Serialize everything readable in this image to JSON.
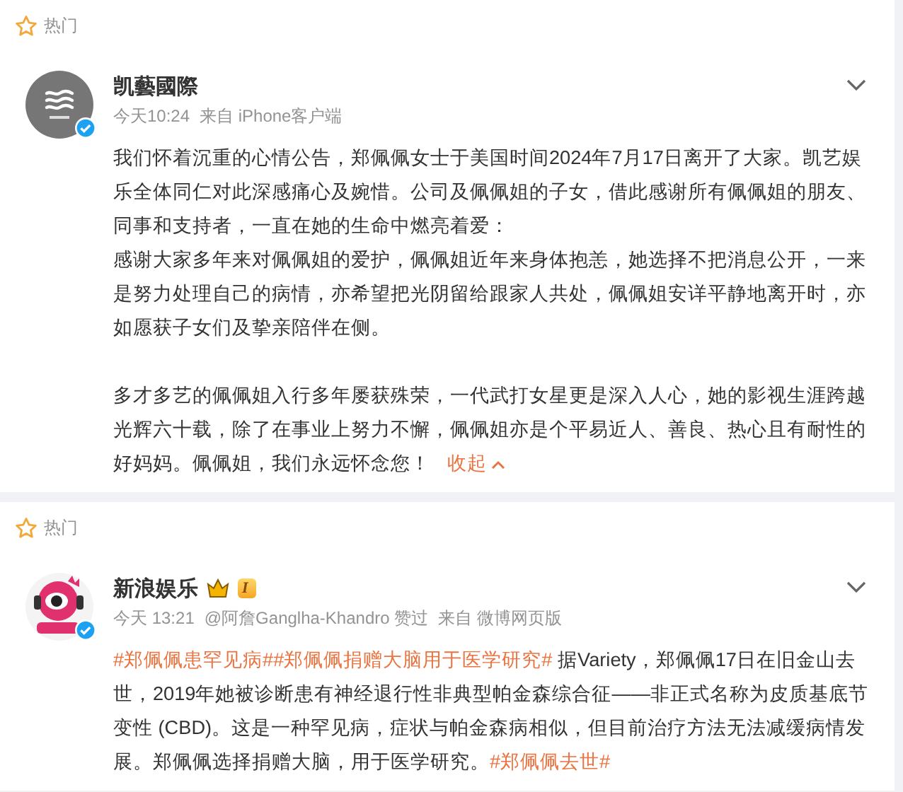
{
  "posts": [
    {
      "section": "热门",
      "author": "凯藝國際",
      "verified": true,
      "meta": [
        "今天10:24",
        "来自 iPhone客户端"
      ],
      "paragraphs": [
        [
          [
            {
              "kind": "text",
              "text": "我们怀着沉重的心情公告，郑佩佩女士于美国时间2024年7月17日离开了大家。凯艺娱"
            }
          ],
          [
            {
              "kind": "text",
              "text": "乐全体同仁对此深感痛心及婉惜。公司及佩佩姐的子女，借此感谢所有佩佩姐的朋友、"
            }
          ],
          [
            {
              "kind": "text",
              "text": "同事和支持者，一直在她的生命中燃亮着爱："
            }
          ],
          [
            {
              "kind": "text",
              "text": "感谢大家多年来对佩佩姐的爱护，佩佩姐近年来身体抱恙，她选择不把消息公开，一来"
            }
          ],
          [
            {
              "kind": "text",
              "text": "是努力处理自己的病情，亦希望把光阴留给跟家人共处，佩佩姐安详平静地离开时，亦"
            }
          ],
          [
            {
              "kind": "text",
              "text": "如愿获子女们及挚亲陪伴在侧。"
            }
          ]
        ],
        [
          [
            {
              "kind": "text",
              "text": "多才多艺的佩佩姐入行多年屡获殊荣，一代武打女星更是深入人心，她的影视生涯跨越"
            }
          ],
          [
            {
              "kind": "text",
              "text": "光辉六十载，除了在事业上努力不懈，佩佩姐亦是个平易近人、善良、热心且有耐性的"
            }
          ],
          [
            {
              "kind": "text",
              "text": "好妈妈。佩佩姐，我们永远怀念您！"
            },
            {
              "kind": "collapse",
              "text": "收起"
            }
          ]
        ]
      ]
    },
    {
      "section": "热门",
      "author": "新浪娱乐",
      "verified": true,
      "level_badge": "I",
      "meta": [
        "今天 13:21",
        "@阿詹Ganglha-Khandro 赞过",
        "来自 微博网页版"
      ],
      "paragraphs": [
        [
          [
            {
              "kind": "hashtag",
              "text": "#郑佩佩患罕见病#"
            },
            {
              "kind": "hashtag",
              "text": "#郑佩佩捐赠大脑用于医学研究#"
            },
            {
              "kind": "text",
              "text": " 据Variety，郑佩佩17日在旧金山去"
            }
          ],
          [
            {
              "kind": "text",
              "text": "世，2019年她被诊断患有神经退行性非典型帕金森综合征——非正式名称为皮质基底节"
            }
          ],
          [
            {
              "kind": "text",
              "text": "变性 (CBD)。这是一种罕见病，症状与帕金森病相似，但目前治疗方法无法减缓病情发"
            }
          ],
          [
            {
              "kind": "text",
              "text": "展。郑佩佩选择捐赠大脑，用于医学研究。"
            },
            {
              "kind": "hashtag",
              "text": "#郑佩佩去世#"
            }
          ]
        ]
      ]
    }
  ]
}
